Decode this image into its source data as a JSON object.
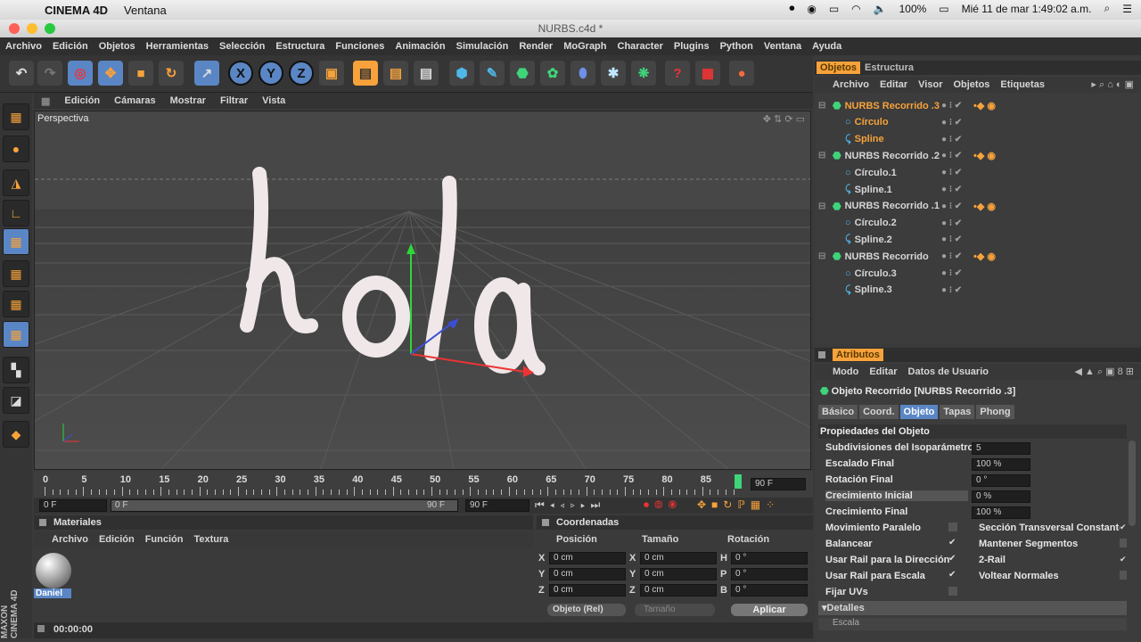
{
  "mac": {
    "app": "CINEMA 4D",
    "window_menu": "Ventana",
    "battery": "100%",
    "datetime": "Mié 11 de mar  1:49:02 a.m."
  },
  "window": {
    "title": "NURBS.c4d *"
  },
  "menu": [
    "Archivo",
    "Edición",
    "Objetos",
    "Herramientas",
    "Selección",
    "Estructura",
    "Funciones",
    "Animación",
    "Simulación",
    "Render",
    "MoGraph",
    "Character",
    "Plugins",
    "Python",
    "Ventana",
    "Ayuda"
  ],
  "toolbar": {
    "axis_x": "X",
    "axis_y": "Y",
    "axis_z": "Z"
  },
  "viewport": {
    "menu": [
      "Edición",
      "Cámaras",
      "Mostrar",
      "Filtrar",
      "Vista"
    ],
    "label": "Perspectiva",
    "scene_text": "hola"
  },
  "timeline": {
    "ticks": [
      "0",
      "5",
      "10",
      "15",
      "20",
      "25",
      "30",
      "35",
      "40",
      "45",
      "50",
      "55",
      "60",
      "65",
      "70",
      "75",
      "80",
      "85"
    ],
    "end_frame": "90 F",
    "start": "0 F",
    "range_start": "0 F",
    "range_end": "90 F",
    "max": "90 F"
  },
  "materials": {
    "title": "Materiales",
    "menu": [
      "Archivo",
      "Edición",
      "Función",
      "Textura"
    ],
    "items": [
      {
        "name": "Daniel"
      }
    ]
  },
  "coords": {
    "title": "Coordenadas",
    "headers": [
      "Posición",
      "Tamaño",
      "Rotación"
    ],
    "rows": [
      {
        "pos_axis": "X",
        "pos": "0 cm",
        "size_axis": "X",
        "size": "0 cm",
        "rot_axis": "H",
        "rot": "0 °"
      },
      {
        "pos_axis": "Y",
        "pos": "0 cm",
        "size_axis": "Y",
        "size": "0 cm",
        "rot_axis": "P",
        "rot": "0 °"
      },
      {
        "pos_axis": "Z",
        "pos": "0 cm",
        "size_axis": "Z",
        "size": "0 cm",
        "rot_axis": "B",
        "rot": "0 °"
      }
    ],
    "mode": "Objeto (Rel)",
    "size_mode": "Tamaño",
    "apply": "Aplicar"
  },
  "status": {
    "time": "00:00:00"
  },
  "objects": {
    "tabs": [
      "Objetos",
      "Estructura"
    ],
    "menu": [
      "Archivo",
      "Editar",
      "Visor",
      "Objetos",
      "Etiquetas"
    ],
    "rows": [
      {
        "name": "NURBS Recorrido .3",
        "indent": 0,
        "type": "nurbs",
        "selected": true
      },
      {
        "name": "Círculo",
        "indent": 1,
        "type": "circle",
        "selected": true
      },
      {
        "name": "Spline",
        "indent": 1,
        "type": "spline",
        "selected": true
      },
      {
        "name": "NURBS Recorrido .2",
        "indent": 0,
        "type": "nurbs",
        "selected": false
      },
      {
        "name": "Círculo.1",
        "indent": 1,
        "type": "circle",
        "selected": false
      },
      {
        "name": "Spline.1",
        "indent": 1,
        "type": "spline",
        "selected": false
      },
      {
        "name": "NURBS Recorrido .1",
        "indent": 0,
        "type": "nurbs",
        "selected": false
      },
      {
        "name": "Círculo.2",
        "indent": 1,
        "type": "circle",
        "selected": false
      },
      {
        "name": "Spline.2",
        "indent": 1,
        "type": "spline",
        "selected": false
      },
      {
        "name": "NURBS Recorrido",
        "indent": 0,
        "type": "nurbs",
        "selected": false
      },
      {
        "name": "Círculo.3",
        "indent": 1,
        "type": "circle",
        "selected": false
      },
      {
        "name": "Spline.3",
        "indent": 1,
        "type": "spline",
        "selected": false
      }
    ]
  },
  "attributes": {
    "title": "Atributos",
    "menu": [
      "Modo",
      "Editar",
      "Datos de Usuario"
    ],
    "object_title": "Objeto Recorrido [NURBS Recorrido .3]",
    "tabs": [
      "Básico",
      "Coord.",
      "Objeto",
      "Tapas",
      "Phong"
    ],
    "active_tab": "Objeto",
    "section": "Propiedades del Objeto",
    "fields": [
      {
        "label": "Subdivisiones del Isoparámetro",
        "value": "5"
      },
      {
        "label": "Escalado Final",
        "value": "100 %"
      },
      {
        "label": "Rotación Final",
        "value": "0 °"
      },
      {
        "label": "Crecimiento Inicial",
        "value": "0 %"
      },
      {
        "label": "Crecimiento Final",
        "value": "100 %"
      }
    ],
    "checks_left": [
      {
        "label": "Movimiento Paralelo",
        "checked": false
      },
      {
        "label": "Balancear",
        "checked": true
      },
      {
        "label": "Usar Rail para la Dirección",
        "checked": true
      },
      {
        "label": "Usar Rail para Escala",
        "checked": true
      },
      {
        "label": "Fijar UVs",
        "checked": false
      }
    ],
    "checks_right": [
      {
        "label": "Sección Transversal Constante",
        "checked": true
      },
      {
        "label": "Mantener Segmentos",
        "checked": false
      },
      {
        "label": "2-Rail",
        "checked": true
      },
      {
        "label": "Voltear Normales",
        "checked": false
      }
    ],
    "details": "Detalles",
    "details_sub": "Escala"
  },
  "brand": {
    "line1": "MAXON",
    "line2": "CINEMA 4D"
  },
  "colors": {
    "accent": "#f7a23b",
    "active_tab": "#5a86c5",
    "green": "#3fd37a"
  }
}
